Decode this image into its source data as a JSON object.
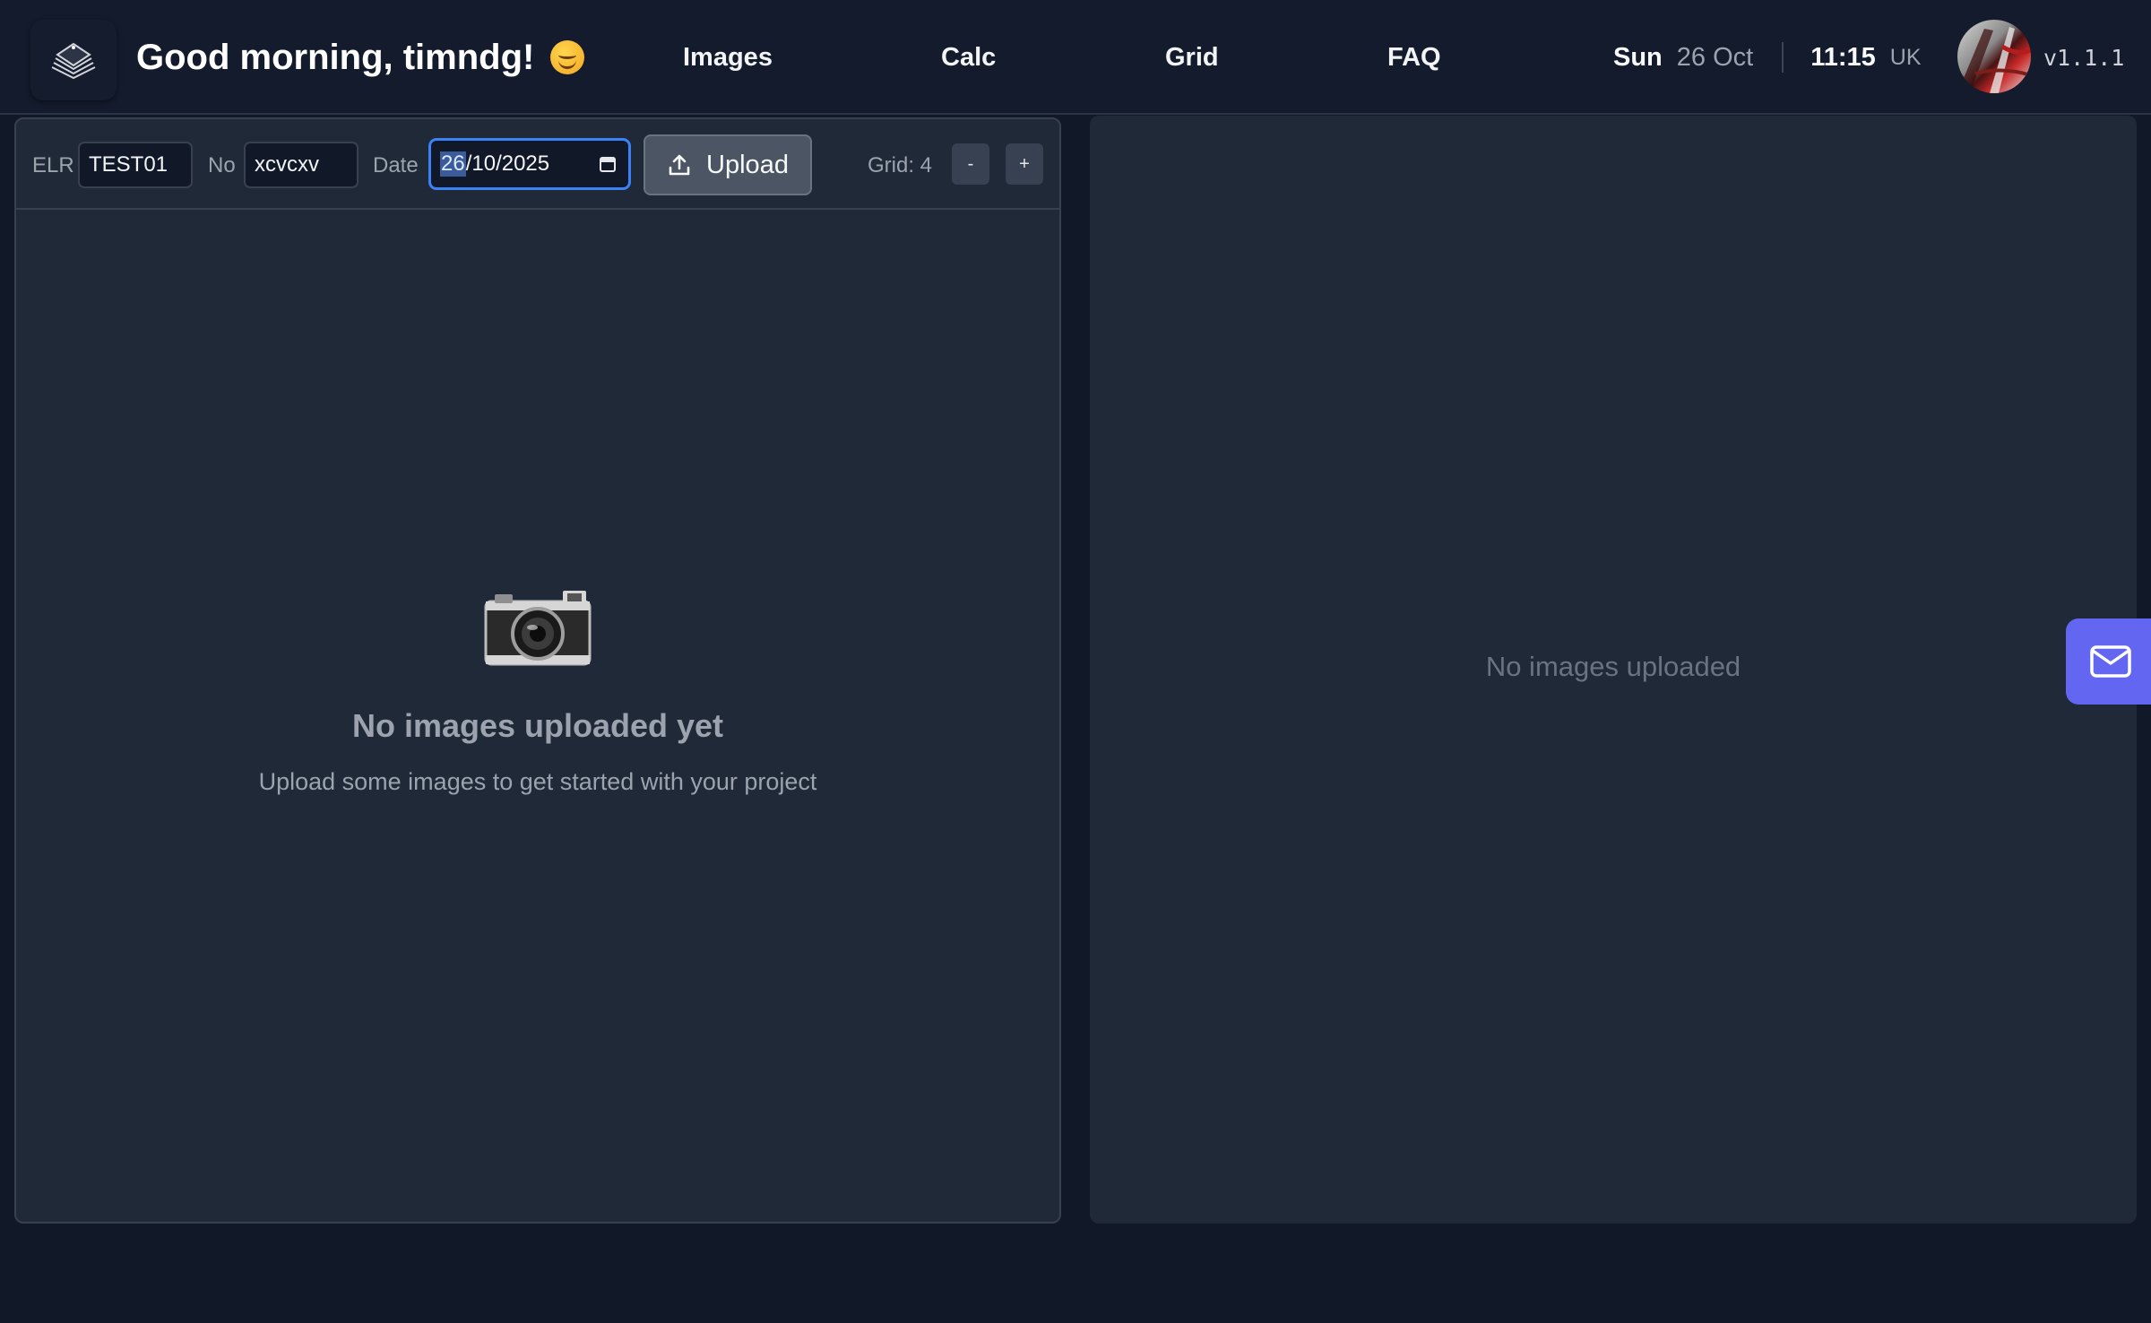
{
  "header": {
    "greeting": "Good morning, timndg!",
    "greeting_emoji": "smiling-face-emoji",
    "nav": [
      {
        "label": "Images"
      },
      {
        "label": "Calc"
      },
      {
        "label": "Grid"
      },
      {
        "label": "FAQ"
      }
    ],
    "day": "Sun",
    "date": "26 Oct",
    "time": "11:15",
    "timezone": "UK",
    "version": "v1.1.1"
  },
  "toolbar": {
    "elr_label": "ELR",
    "elr_value": "TEST01",
    "no_label": "No",
    "no_value": "xcvcxv",
    "date_label": "Date",
    "date_day": "26",
    "date_rest": "/10/2025",
    "upload_label": "Upload",
    "grid_label": "Grid: 4",
    "minus_label": "-",
    "plus_label": "+"
  },
  "left_panel": {
    "empty_title": "No images uploaded yet",
    "empty_subtitle": "Upload some images to get started with your project"
  },
  "right_panel": {
    "empty_text": "No images uploaded"
  },
  "icons": {
    "logo": "layered-stack-logo-icon",
    "calendar": "calendar-icon",
    "upload": "upload-icon",
    "camera": "camera-icon",
    "mail": "mail-icon"
  },
  "colors": {
    "background": "#111827",
    "header": "#131b2d",
    "panel": "#1f2937",
    "accent": "#6366f1",
    "focus": "#3b82f6"
  }
}
